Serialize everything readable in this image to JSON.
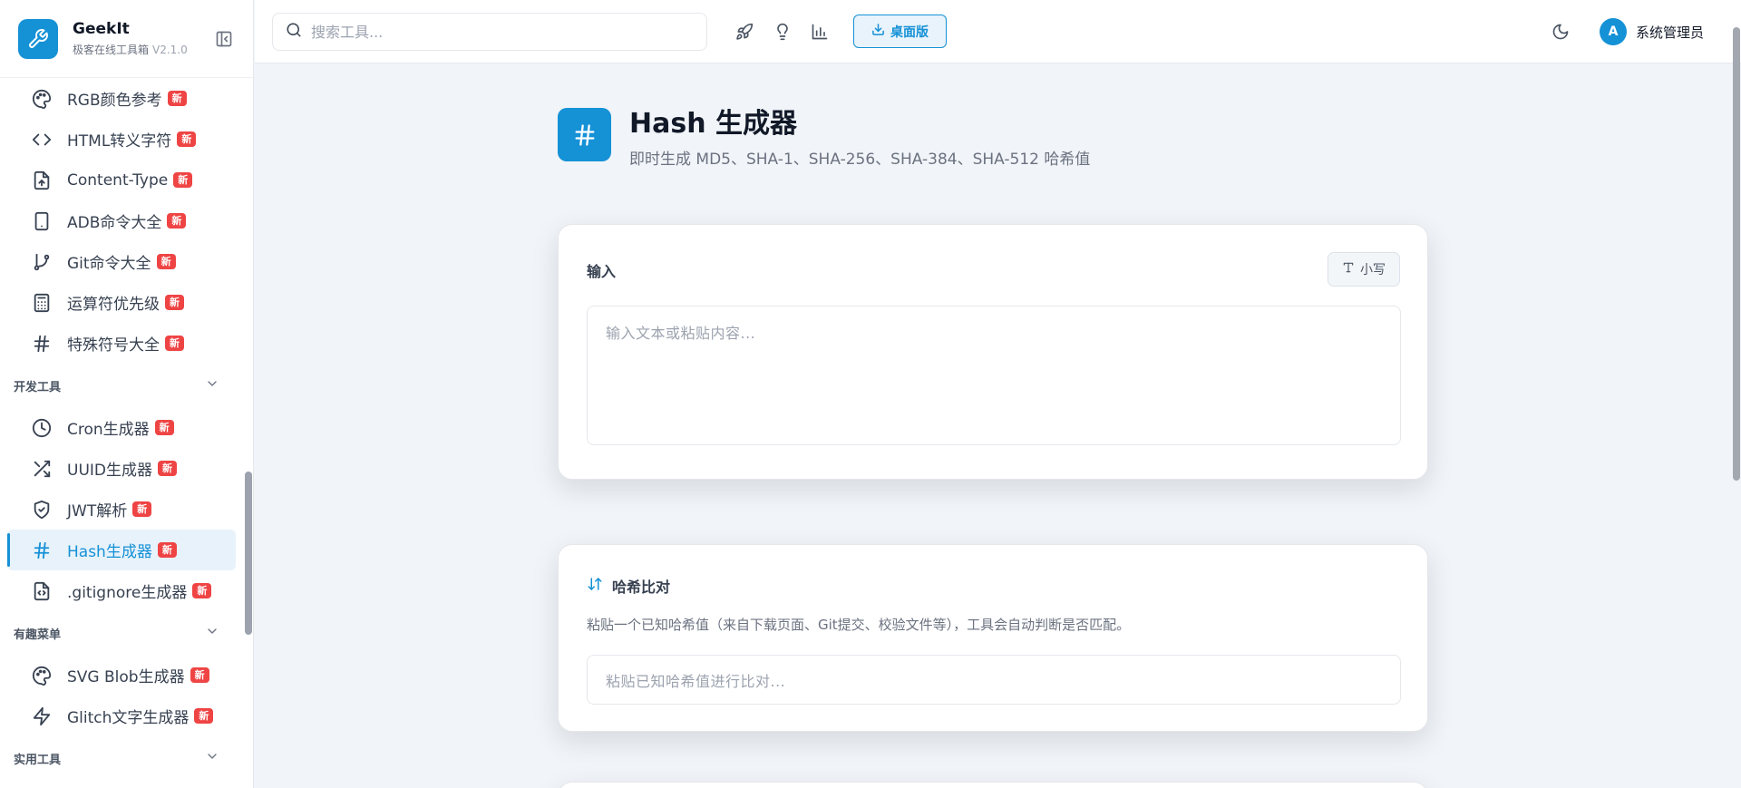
{
  "app": {
    "name": "GeekIt",
    "subtitle": "极客在线工具箱",
    "version": "V2.1.0"
  },
  "sidebar": {
    "items_top": [
      {
        "icon": "palette-icon",
        "label": "RGB颜色参考",
        "badge": "新"
      },
      {
        "icon": "code-icon",
        "label": "HTML转义字符",
        "badge": "新"
      },
      {
        "icon": "file-icon",
        "label": "Content-Type",
        "badge": "新"
      },
      {
        "icon": "phone-icon",
        "label": "ADB命令大全",
        "badge": "新"
      },
      {
        "icon": "git-branch-icon",
        "label": "Git命令大全",
        "badge": "新"
      },
      {
        "icon": "calculator-icon",
        "label": "运算符优先级",
        "badge": "新"
      },
      {
        "icon": "hash-icon",
        "label": "特殊符号大全",
        "badge": "新"
      }
    ],
    "group_dev": "开发工具",
    "items_dev": [
      {
        "icon": "clock-icon",
        "label": "Cron生成器",
        "badge": "新"
      },
      {
        "icon": "shuffle-icon",
        "label": "UUID生成器",
        "badge": "新"
      },
      {
        "icon": "shield-icon",
        "label": "JWT解析",
        "badge": "新"
      },
      {
        "icon": "hash-icon",
        "label": "Hash生成器",
        "badge": "新",
        "active": true
      },
      {
        "icon": "file-code-icon",
        "label": ".gitignore生成器",
        "badge": "新"
      }
    ],
    "group_fun": "有趣菜单",
    "items_fun": [
      {
        "icon": "palette-icon",
        "label": "SVG Blob生成器",
        "badge": "新"
      },
      {
        "icon": "zap-icon",
        "label": "Glitch文字生成器",
        "badge": "新"
      }
    ],
    "group_util": "实用工具"
  },
  "topbar": {
    "search_placeholder": "搜索工具...",
    "desktop_label": "桌面版",
    "user_initial": "A",
    "user_name": "系统管理员"
  },
  "page": {
    "title": "Hash 生成器",
    "subtitle": "即时生成 MD5、SHA-1、SHA-256、SHA-384、SHA-512 哈希值"
  },
  "input_card": {
    "title": "输入",
    "case_label": "小写",
    "placeholder": "输入文本或粘贴内容..."
  },
  "compare_card": {
    "title": "哈希比对",
    "description": "粘贴一个已知哈希值（来自下载页面、Git提交、校验文件等），工具会自动判断是否匹配。",
    "placeholder": "粘贴已知哈希值进行比对..."
  },
  "colors": {
    "accent": "#1591d6",
    "badge": "#ef4444",
    "background": "#f1f4f8"
  }
}
